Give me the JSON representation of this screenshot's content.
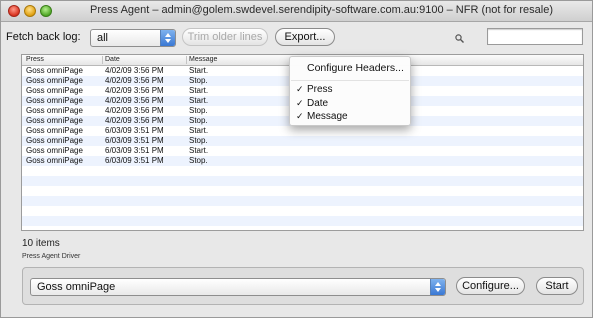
{
  "window": {
    "title": "Press Agent – admin@golem.swdevel.serendipity-software.com.au:9100 – NFR (not for resale)"
  },
  "toolbar": {
    "fetch_label": "Fetch back log:",
    "fetch_value": "all",
    "trim_button": "Trim older lines",
    "export_button": "Export...",
    "search_value": ""
  },
  "table": {
    "headers": [
      "Press",
      "Date",
      "Message"
    ],
    "rows": [
      {
        "press": "Goss omniPage",
        "date": "4/02/09 3:56 PM",
        "message": "Start."
      },
      {
        "press": "Goss omniPage",
        "date": "4/02/09 3:56 PM",
        "message": "Stop."
      },
      {
        "press": "Goss omniPage",
        "date": "4/02/09 3:56 PM",
        "message": "Start."
      },
      {
        "press": "Goss omniPage",
        "date": "4/02/09 3:56 PM",
        "message": "Start."
      },
      {
        "press": "Goss omniPage",
        "date": "4/02/09 3:56 PM",
        "message": "Stop."
      },
      {
        "press": "Goss omniPage",
        "date": "4/02/09 3:56 PM",
        "message": "Stop."
      },
      {
        "press": "Goss omniPage",
        "date": "6/03/09 3:51 PM",
        "message": "Start."
      },
      {
        "press": "Goss omniPage",
        "date": "6/03/09 3:51 PM",
        "message": "Stop."
      },
      {
        "press": "Goss omniPage",
        "date": "6/03/09 3:51 PM",
        "message": "Start."
      },
      {
        "press": "Goss omniPage",
        "date": "6/03/09 3:51 PM",
        "message": "Stop."
      }
    ]
  },
  "context_menu": {
    "configure_headers": "Configure Headers...",
    "columns": [
      {
        "label": "Press",
        "checked": true
      },
      {
        "label": "Date",
        "checked": true
      },
      {
        "label": "Message",
        "checked": true
      }
    ],
    "check_mark": "✓"
  },
  "status": {
    "items_count": "10 items"
  },
  "driver": {
    "group_label": "Press Agent Driver",
    "selected": "Goss omniPage",
    "configure_button": "Configure...",
    "start_button": "Start"
  },
  "colors": {
    "row_alt": "#edf3fe",
    "popup_accent": "#3a78d4",
    "close": "#d9321f",
    "minimize": "#e0a010",
    "zoom": "#4fa626"
  }
}
